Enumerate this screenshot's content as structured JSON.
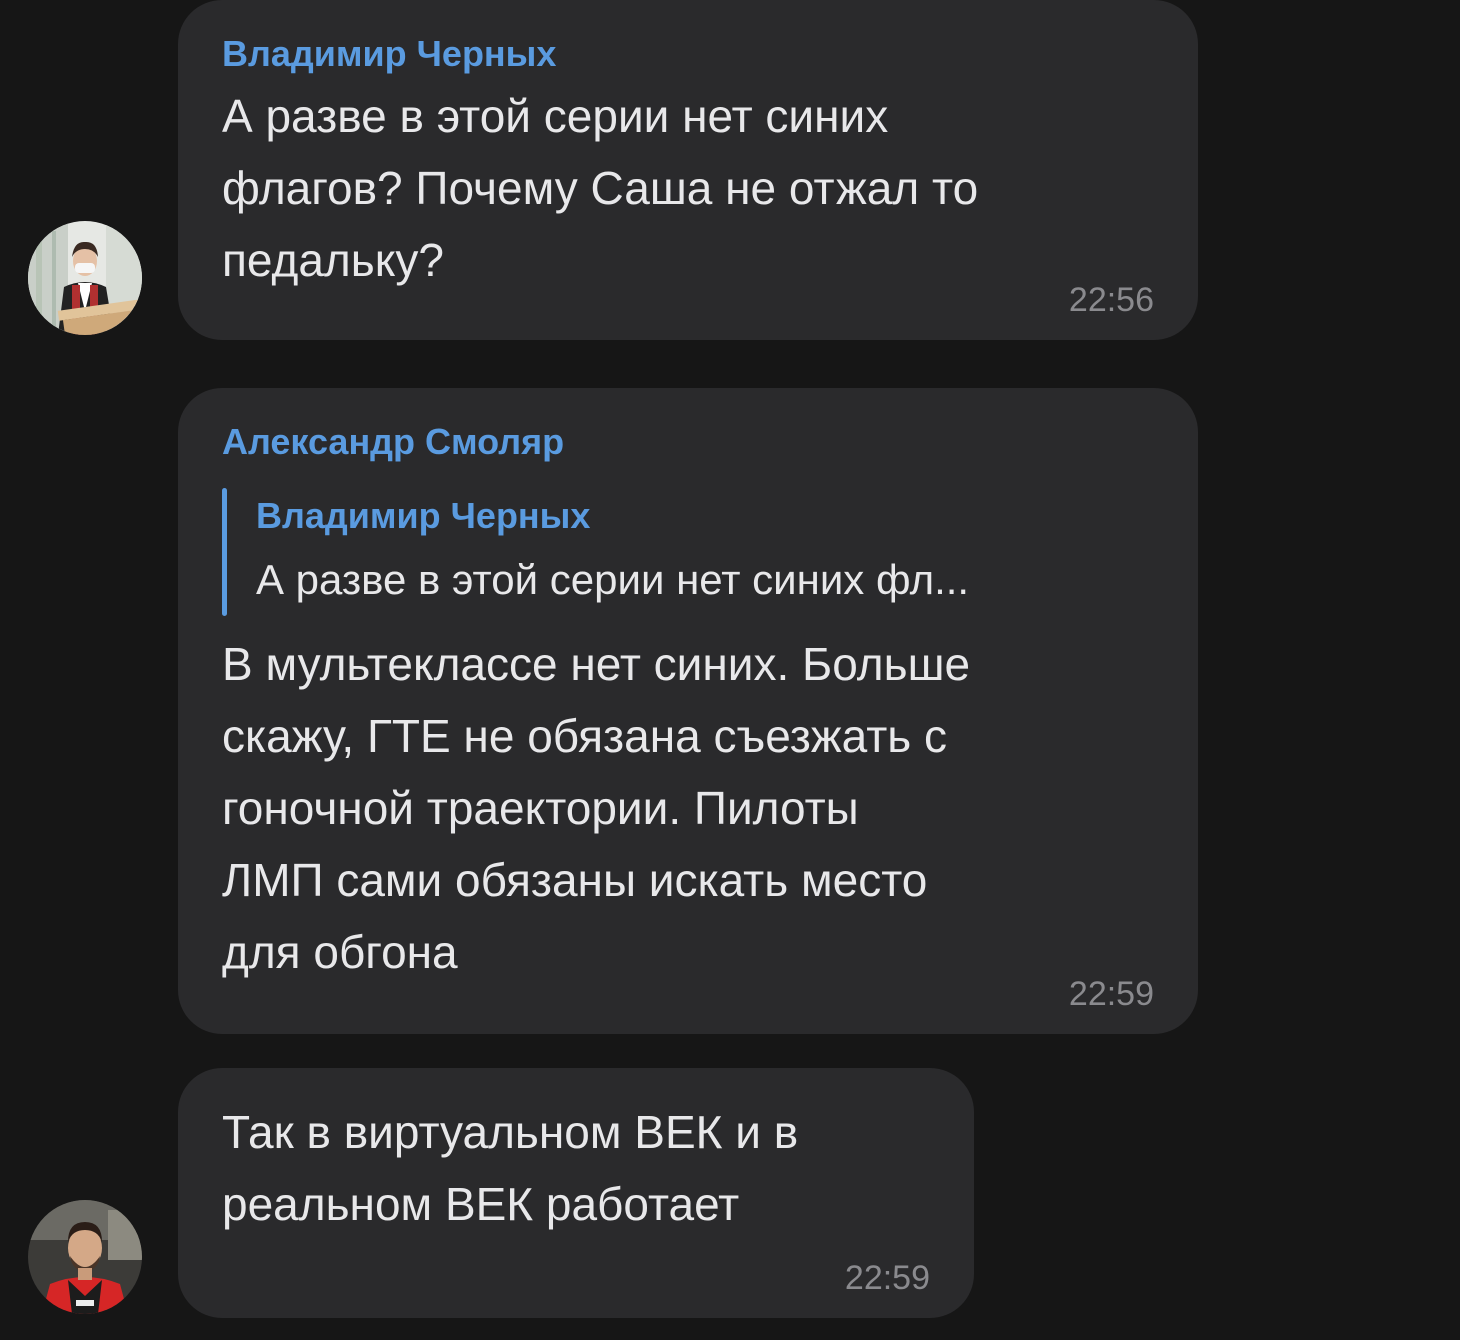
{
  "messages": [
    {
      "sender": "Владимир Черных",
      "lines": [
        "А разве в этой серии нет синих",
        "флагов? Почему Саша не отжал то",
        "педальку?"
      ],
      "time": "22:56",
      "avatar_icon": "user-avatar-man-suit-mask"
    },
    {
      "sender": "Александр Смоляр",
      "reply": {
        "sender": "Владимир Черных",
        "text": "А разве в этой серии нет синих фл..."
      },
      "lines": [
        "В мультеклассе нет синих. Больше",
        "скажу, ГТЕ не обязана съезжать с",
        "гоночной траектории. Пилоты",
        "ЛМП сами обязаны искать место",
        "для обгона"
      ],
      "time": "22:59"
    },
    {
      "lines": [
        "Так в виртуальном ВЕК и в",
        "реальном ВЕК работает"
      ],
      "time": "22:59",
      "avatar_icon": "user-avatar-racing-driver"
    }
  ],
  "colors": {
    "background": "#161616",
    "bubble": "#2a2a2c",
    "sender_name": "#5a9be0",
    "message_text": "#e8e8ea",
    "timestamp": "#8a8a8e"
  }
}
